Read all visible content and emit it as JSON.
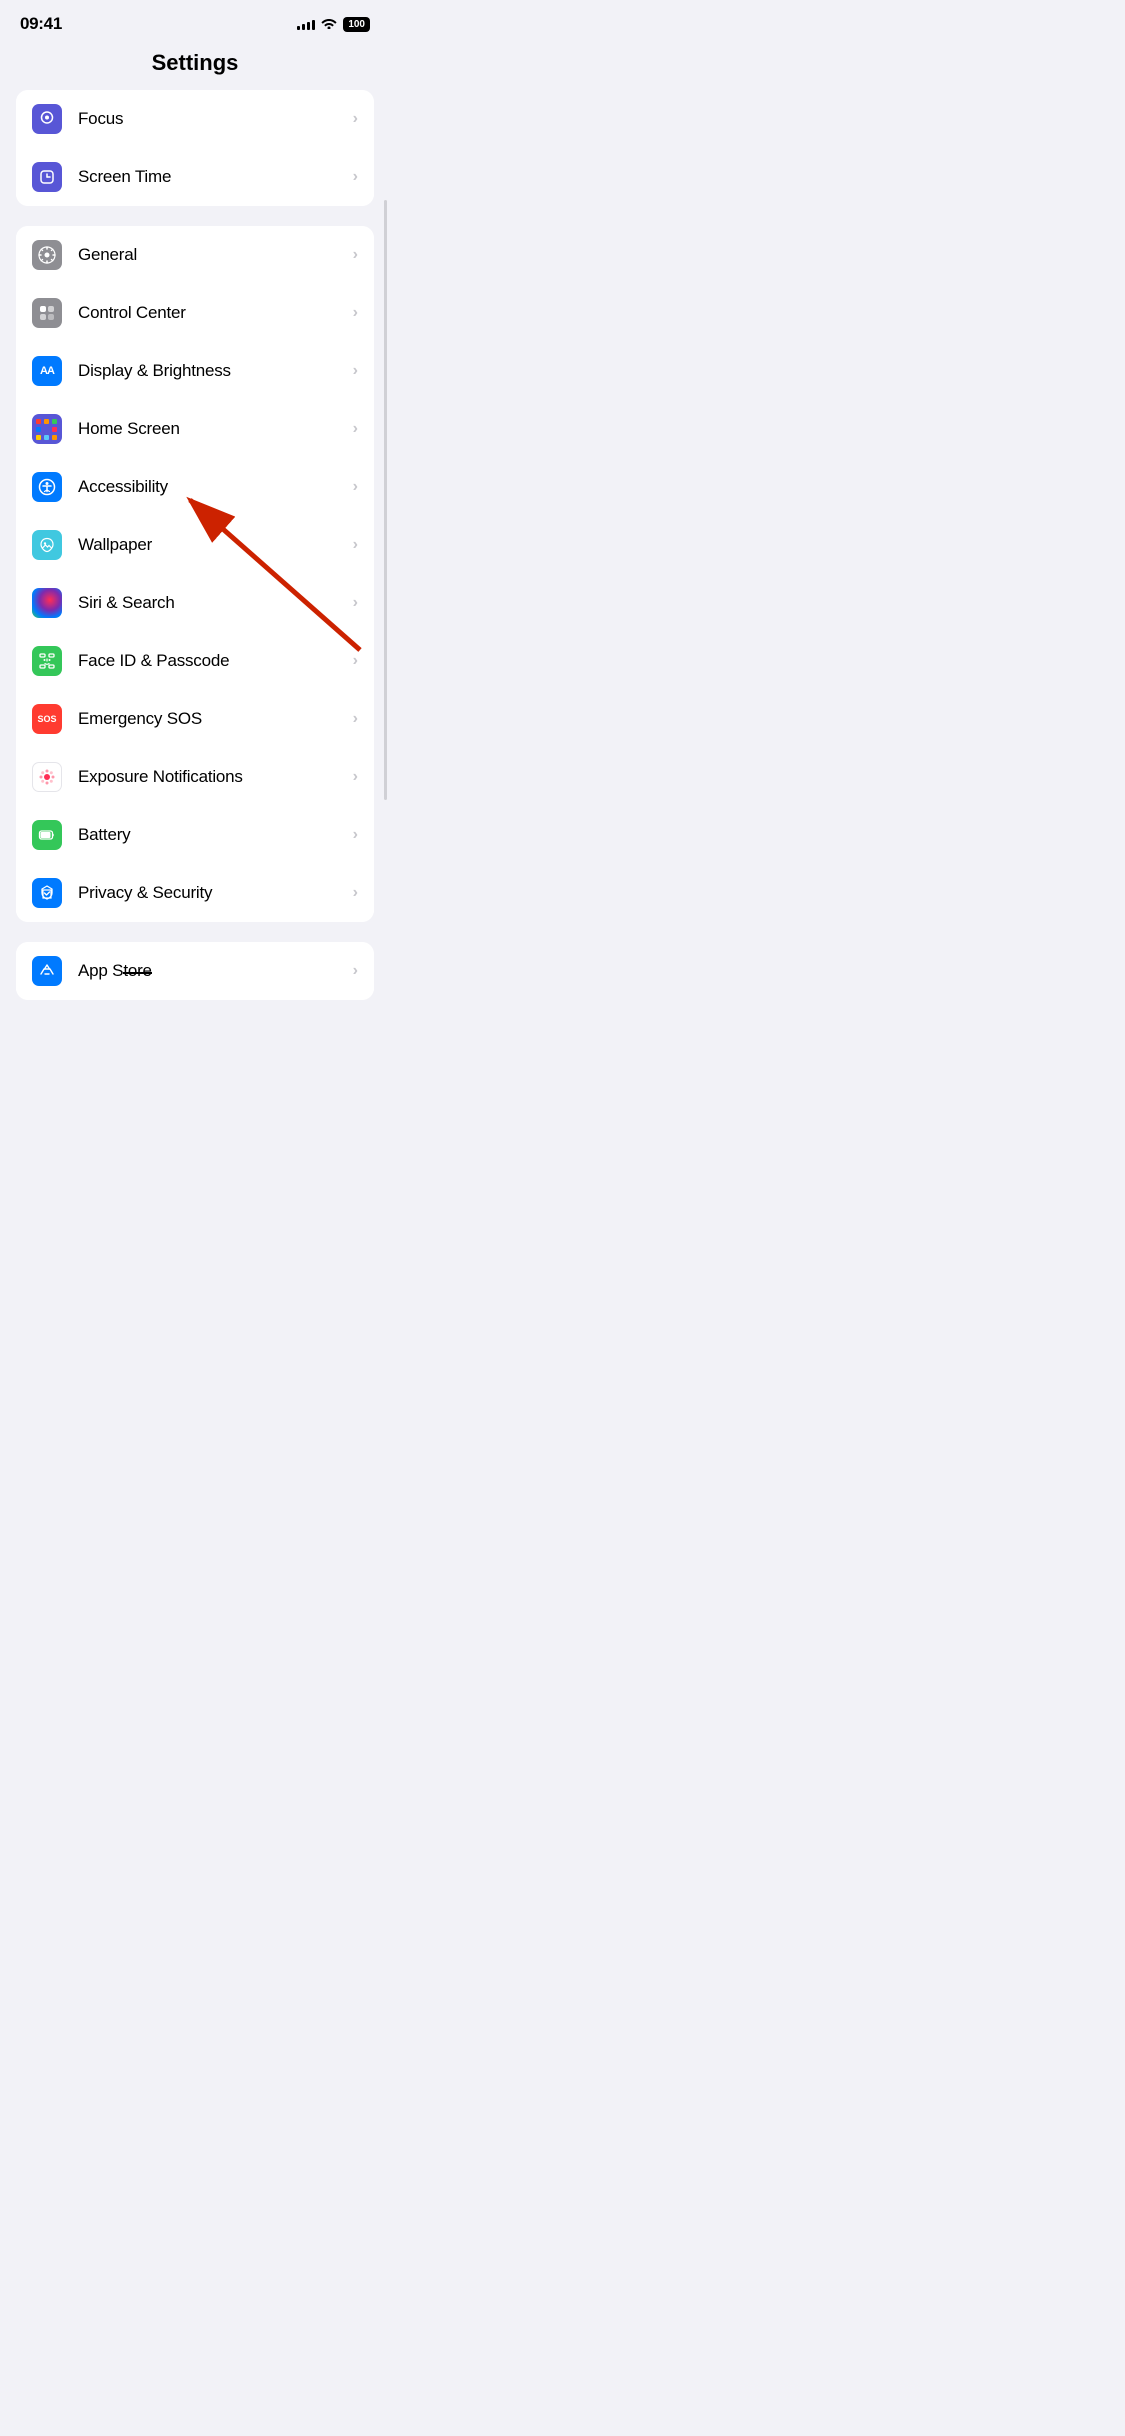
{
  "statusBar": {
    "time": "09:41",
    "battery": "100"
  },
  "pageTitle": "Settings",
  "groups": [
    {
      "id": "group1",
      "items": [
        {
          "id": "focus",
          "label": "Focus",
          "iconColor": "icon-purple",
          "iconSymbol": "🌙"
        },
        {
          "id": "screen-time",
          "label": "Screen Time",
          "iconColor": "icon-purple",
          "iconSymbol": "⏳"
        }
      ]
    },
    {
      "id": "group2",
      "items": [
        {
          "id": "general",
          "label": "General",
          "iconColor": "icon-gray",
          "iconSymbol": "⚙️"
        },
        {
          "id": "control-center",
          "label": "Control Center",
          "iconColor": "icon-gray",
          "iconSymbol": "🎛️"
        },
        {
          "id": "display-brightness",
          "label": "Display & Brightness",
          "iconColor": "icon-blue",
          "iconSymbol": "AA"
        },
        {
          "id": "home-screen",
          "label": "Home Screen",
          "iconColor": "icon-indigo",
          "iconSymbol": "⊞",
          "hasArrow": true
        },
        {
          "id": "accessibility",
          "label": "Accessibility",
          "iconColor": "icon-blue",
          "iconSymbol": "♿"
        },
        {
          "id": "wallpaper",
          "label": "Wallpaper",
          "iconColor": "icon-dark-teal",
          "iconSymbol": "🌸"
        },
        {
          "id": "siri-search",
          "label": "Siri & Search",
          "iconColor": "icon-dark",
          "iconSymbol": "✦"
        },
        {
          "id": "face-id",
          "label": "Face ID & Passcode",
          "iconColor": "icon-green",
          "iconSymbol": "🙂"
        },
        {
          "id": "emergency-sos",
          "label": "Emergency SOS",
          "iconColor": "icon-red",
          "iconSymbol": "SOS"
        },
        {
          "id": "exposure",
          "label": "Exposure Notifications",
          "iconColor": "icon-pink",
          "iconSymbol": "●"
        },
        {
          "id": "battery",
          "label": "Battery",
          "iconColor": "icon-green",
          "iconSymbol": "🔋"
        },
        {
          "id": "privacy",
          "label": "Privacy & Security",
          "iconColor": "icon-blue",
          "iconSymbol": "✋"
        }
      ]
    },
    {
      "id": "group3",
      "items": [
        {
          "id": "app-store",
          "label": "App Store",
          "iconColor": "icon-blue",
          "iconSymbol": "A",
          "strikethrough": true
        }
      ]
    }
  ]
}
